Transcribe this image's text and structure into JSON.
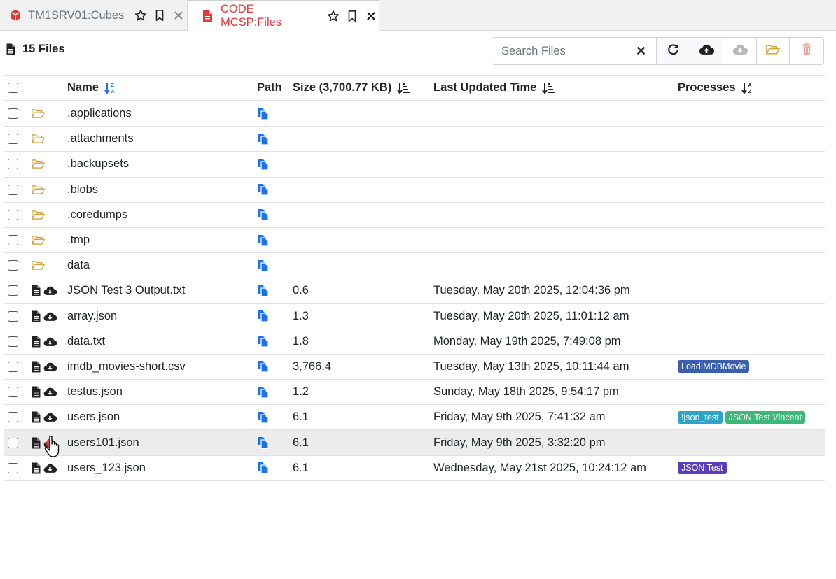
{
  "tabs": [
    {
      "label": "TM1SRV01:Cubes",
      "icon": "cube-icon",
      "active": false
    },
    {
      "label": "CODE MCSP:Files",
      "icon": "file-icon",
      "active": true
    }
  ],
  "header": {
    "files_count": "15 Files"
  },
  "search": {
    "placeholder": "Search Files",
    "value": ""
  },
  "toolbar": {
    "buttons": [
      "refresh-icon",
      "cloud-upload-icon",
      "cloud-download-icon",
      "folder-open-icon",
      "trash-icon"
    ]
  },
  "table": {
    "columns": {
      "name": "Name",
      "path": "Path",
      "size": "Size (3,700.77 KB)",
      "time": "Last Updated Time",
      "processes": "Processes"
    },
    "rows": [
      {
        "type": "folder",
        "name": ".applications",
        "size": "",
        "time": "",
        "processes": []
      },
      {
        "type": "folder",
        "name": ".attachments",
        "size": "",
        "time": "",
        "processes": []
      },
      {
        "type": "folder",
        "name": ".backupsets",
        "size": "",
        "time": "",
        "processes": []
      },
      {
        "type": "folder",
        "name": ".blobs",
        "size": "",
        "time": "",
        "processes": []
      },
      {
        "type": "folder",
        "name": ".coredumps",
        "size": "",
        "time": "",
        "processes": []
      },
      {
        "type": "folder",
        "name": ".tmp",
        "size": "",
        "time": "",
        "processes": []
      },
      {
        "type": "folder",
        "name": "data",
        "size": "",
        "time": "",
        "processes": []
      },
      {
        "type": "file",
        "name": "JSON Test 3 Output.txt",
        "size": "0.6",
        "time": "Tuesday, May 20th 2025, 12:04:36 pm",
        "processes": []
      },
      {
        "type": "file",
        "name": "array.json",
        "size": "1.3",
        "time": "Tuesday, May 20th 2025, 11:01:12 am",
        "processes": []
      },
      {
        "type": "file",
        "name": "data.txt",
        "size": "1.8",
        "time": "Monday, May 19th 2025, 7:49:08 pm",
        "processes": []
      },
      {
        "type": "file",
        "name": "imdb_movies-short.csv",
        "size": "3,766.4",
        "time": "Tuesday, May 13th 2025, 10:11:44 am",
        "processes": [
          {
            "label": "LoadIMDBMovie",
            "color": "#3a5fae"
          }
        ]
      },
      {
        "type": "file",
        "name": "testus.json",
        "size": "1.2",
        "time": "Sunday, May 18th 2025, 9:54:17 pm",
        "processes": []
      },
      {
        "type": "file",
        "name": "users.json",
        "size": "6.1",
        "time": "Friday, May 9th 2025, 7:41:32 am",
        "processes": [
          {
            "label": "!json_test",
            "color": "#2fa3c4"
          },
          {
            "label": "JSON Test Vincent",
            "color": "#3cb878"
          }
        ]
      },
      {
        "type": "file",
        "name": "users101.json",
        "size": "6.1",
        "time": "Friday, May 9th 2025, 3:32:20 pm",
        "processes": [],
        "hover": true
      },
      {
        "type": "file",
        "name": "users_123.json",
        "size": "6.1",
        "time": "Wednesday, May 21st 2025, 10:24:12 am",
        "processes": [
          {
            "label": "JSON Test",
            "color": "#5a3eb8"
          }
        ]
      }
    ]
  },
  "colors": {
    "accent": "#1a73e8",
    "folder": "#d4a23a",
    "tab_active": "#e0393e"
  }
}
